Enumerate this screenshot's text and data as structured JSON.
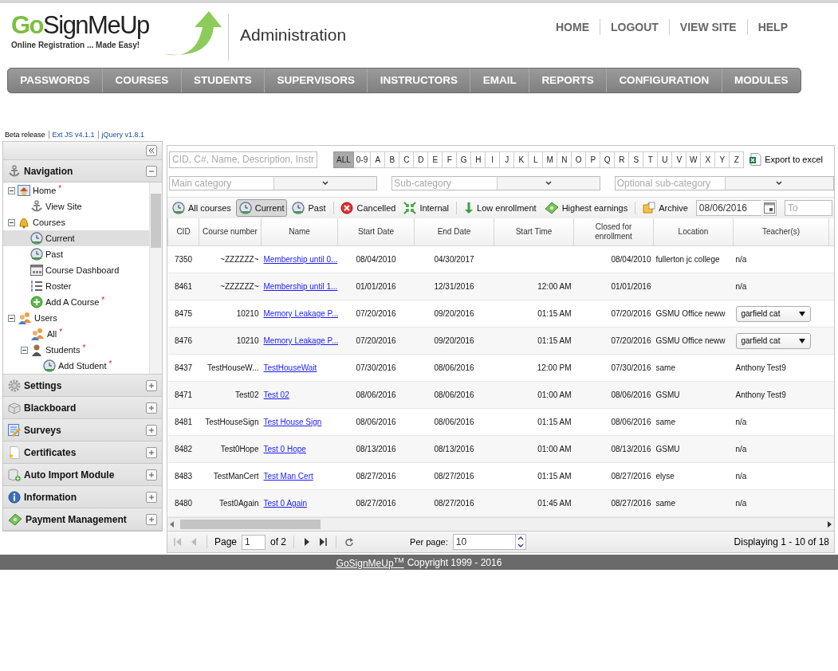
{
  "header": {
    "logo": {
      "brand_highlight": "Go",
      "brand_rest": "SignMeUp",
      "tagline": "Online Registration ... Made Easy!"
    },
    "section_title": "Administration",
    "top_links": [
      "HOME",
      "LOGOUT",
      "VIEW SITE",
      "HELP"
    ],
    "main_menu": [
      "PASSWORDS",
      "COURSES",
      "STUDENTS",
      "SUPERVISORS",
      "INSTRUCTORS",
      "EMAIL",
      "REPORTS",
      "CONFIGURATION",
      "MODULES"
    ]
  },
  "version_bar": [
    "Beta release",
    "Ext JS v4.1.1",
    "jQuery v1.8.1"
  ],
  "sidebar": {
    "panels": [
      {
        "title": "Navigation",
        "expanded": true,
        "tree": [
          {
            "label": "Home",
            "required": "*",
            "expanded": true,
            "selected": false,
            "children": [
              {
                "label": "View Site",
                "selected": false
              }
            ]
          },
          {
            "label": "Courses",
            "expanded": true,
            "selected": false,
            "children": [
              {
                "label": "Current",
                "selected": true
              },
              {
                "label": "Past",
                "selected": false
              },
              {
                "label": "Course Dashboard",
                "selected": false
              },
              {
                "label": "Roster",
                "selected": false
              },
              {
                "label": "Add A Course",
                "required": "*",
                "selected": false
              }
            ]
          },
          {
            "label": "Users",
            "expanded": true,
            "selected": false,
            "children": [
              {
                "label": "All",
                "required": "*",
                "selected": false
              },
              {
                "label": "Students",
                "required": "*",
                "expanded": true,
                "selected": false,
                "children": [
                  {
                    "label": "Add Student",
                    "required": "*",
                    "selected": false
                  }
                ]
              }
            ]
          }
        ]
      },
      {
        "title": "Settings",
        "expanded": false
      },
      {
        "title": "Blackboard",
        "expanded": false
      },
      {
        "title": "Surveys",
        "expanded": false
      },
      {
        "title": "Certificates",
        "expanded": false
      },
      {
        "title": "Auto Import Module",
        "expanded": false
      },
      {
        "title": "Information",
        "expanded": false
      },
      {
        "title": "Payment Management",
        "expanded": false
      }
    ]
  },
  "course_grid": {
    "search": {
      "placeholder": "CID, C#, Name, Description, Instr"
    },
    "letters": [
      {
        "label": "ALL",
        "selected": true
      },
      {
        "label": "0-9",
        "selected": false
      },
      {
        "label": "A",
        "selected": false
      },
      {
        "label": "B",
        "selected": false
      },
      {
        "label": "C",
        "selected": false
      },
      {
        "label": "D",
        "selected": false
      },
      {
        "label": "E",
        "selected": false
      },
      {
        "label": "F",
        "selected": false
      },
      {
        "label": "G",
        "selected": false
      },
      {
        "label": "H",
        "selected": false
      },
      {
        "label": "I",
        "selected": false
      },
      {
        "label": "J",
        "selected": false
      },
      {
        "label": "K",
        "selected": false
      },
      {
        "label": "L",
        "selected": false
      },
      {
        "label": "M",
        "selected": false
      },
      {
        "label": "N",
        "selected": false
      },
      {
        "label": "O",
        "selected": false
      },
      {
        "label": "P",
        "selected": false
      },
      {
        "label": "Q",
        "selected": false
      },
      {
        "label": "R",
        "selected": false
      },
      {
        "label": "S",
        "selected": false
      },
      {
        "label": "T",
        "selected": false
      },
      {
        "label": "U",
        "selected": false
      },
      {
        "label": "V",
        "selected": false
      },
      {
        "label": "W",
        "selected": false
      },
      {
        "label": "X",
        "selected": false
      },
      {
        "label": "Y",
        "selected": false
      },
      {
        "label": "Z",
        "selected": false
      }
    ],
    "export_label": "Export to excel",
    "categories": [
      {
        "placeholder": "Main category"
      },
      {
        "placeholder": "Sub-category"
      },
      {
        "placeholder": "Optional sub-category"
      }
    ],
    "filter_groups": [
      [
        {
          "label": "All courses",
          "selected": false
        },
        {
          "label": "Current",
          "selected": true
        },
        {
          "label": "Past",
          "selected": false
        }
      ],
      [
        {
          "label": "Cancelled",
          "selected": false
        },
        {
          "label": "Internal",
          "selected": false
        }
      ],
      [
        {
          "label": "Low enrollment",
          "selected": false
        },
        {
          "label": "Highest earnings",
          "selected": false
        }
      ],
      [
        {
          "label": "Archive",
          "selected": false
        }
      ]
    ],
    "date_from": {
      "value": "08/06/2016"
    },
    "date_to": {
      "placeholder": "To"
    },
    "columns": [
      "CID",
      "Course number",
      "Name",
      "Start Date",
      "End Date",
      "Start Time",
      "Closed for enrollment",
      "Location",
      "Teacher(s)"
    ],
    "rows": [
      {
        "cid": "7350",
        "course_number": "~ZZZZZZ~",
        "name": "Membership until 0...",
        "start_date": "08/04/2010",
        "end_date": "04/30/2017",
        "closed": "08/04/2010",
        "location": "fullerton jc college",
        "teacher": {
          "kind": "text",
          "value": "n/a"
        }
      },
      {
        "cid": "8461",
        "course_number": "~ZZZZZZ~",
        "name": "Membership until 1...",
        "start_date": "01/01/2016",
        "end_date": "12/31/2016",
        "start_time": "12:00 AM",
        "closed": "01/01/2016",
        "teacher": {
          "kind": "text",
          "value": "n/a"
        }
      },
      {
        "cid": "8475",
        "course_number": "10210",
        "name": "Memory Leakage P...",
        "start_date": "07/20/2016",
        "end_date": "09/20/2016",
        "start_time": "01:15 AM",
        "closed": "07/20/2016",
        "location": "GSMU Office neww",
        "teacher": {
          "kind": "select",
          "value": "garfield cat"
        }
      },
      {
        "cid": "8476",
        "course_number": "10210",
        "name": "Memory Leakage P...",
        "start_date": "07/20/2016",
        "end_date": "09/20/2016",
        "start_time": "01:15 AM",
        "closed": "07/20/2016",
        "location": "GSMU Office neww",
        "teacher": {
          "kind": "select",
          "value": "garfield cat"
        }
      },
      {
        "cid": "8437",
        "course_number": "TestHouseW...",
        "name": "TestHouseWait",
        "start_date": "07/30/2016",
        "end_date": "08/06/2016",
        "start_time": "12:00 PM",
        "closed": "07/30/2016",
        "location": "same",
        "teacher": {
          "kind": "text",
          "value": "Anthony Test9"
        }
      },
      {
        "cid": "8471",
        "course_number": "Test02",
        "name": "Test 02",
        "start_date": "08/06/2016",
        "end_date": "08/06/2016",
        "start_time": "01:00 AM",
        "closed": "08/06/2016",
        "location": "GSMU",
        "teacher": {
          "kind": "text",
          "value": "Anthony Test9"
        }
      },
      {
        "cid": "8481",
        "course_number": "TestHouseSign",
        "name": "Test House Sign",
        "start_date": "08/06/2016",
        "end_date": "08/06/2016",
        "start_time": "01:15 AM",
        "closed": "08/06/2016",
        "location": "same",
        "teacher": {
          "kind": "text",
          "value": "n/a"
        }
      },
      {
        "cid": "8482",
        "course_number": "Test0Hope",
        "name": "Test 0 Hope",
        "start_date": "08/13/2016",
        "end_date": "08/13/2016",
        "start_time": "01:00 AM",
        "closed": "08/13/2016",
        "location": "GSMU",
        "teacher": {
          "kind": "text",
          "value": "n/a"
        }
      },
      {
        "cid": "8483",
        "course_number": "TestManCert",
        "name": "Test Man Cert",
        "start_date": "08/27/2016",
        "end_date": "08/27/2016",
        "start_time": "01:15 AM",
        "closed": "08/27/2016",
        "location": "elyse",
        "teacher": {
          "kind": "text",
          "value": "n/a"
        }
      },
      {
        "cid": "8480",
        "course_number": "Test0Again",
        "name": "Test 0 Again",
        "start_date": "08/27/2016",
        "end_date": "08/27/2016",
        "start_time": "01:45 AM",
        "closed": "08/27/2016",
        "location": "same",
        "teacher": {
          "kind": "text",
          "value": "n/a"
        }
      }
    ],
    "paging": {
      "page_label": "Page",
      "page_value": "1",
      "page_count": "of 2",
      "per_page_label": "Per page:",
      "per_page_value": "10",
      "display": "Displaying 1 - 10 of 18"
    }
  },
  "footer": {
    "brand_link": "GoSignMeUp$^{TM}$",
    "copyright": "Copyright 1999 - 2016"
  }
}
